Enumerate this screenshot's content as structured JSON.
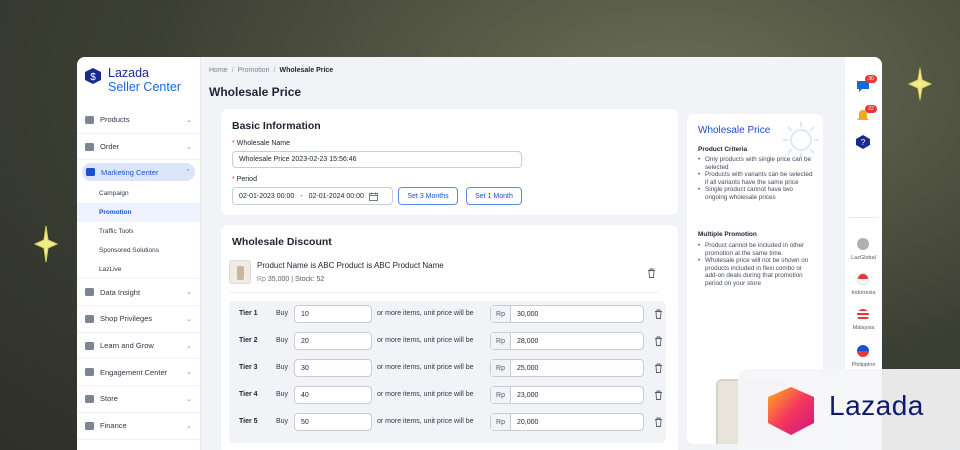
{
  "app": {
    "brand": "Lazada",
    "product": "Seller Center"
  },
  "sidebar": {
    "items": [
      {
        "label": "Products",
        "icon": "box-icon"
      },
      {
        "label": "Order",
        "icon": "order-icon"
      },
      {
        "label": "Marketing Center",
        "icon": "marketing-icon",
        "active": true
      },
      {
        "label": "Data Insight",
        "icon": "chart-icon"
      },
      {
        "label": "Shop Privileges",
        "icon": "shop-icon"
      },
      {
        "label": "Learn and Grow",
        "icon": "learn-icon"
      },
      {
        "label": "Engagement Center",
        "icon": "engagement-icon"
      },
      {
        "label": "Store",
        "icon": "store-icon"
      },
      {
        "label": "Finance",
        "icon": "finance-icon"
      }
    ],
    "sub_items": [
      "Campaign",
      "Promotion",
      "Traffic Tools",
      "Sponsored Solutions",
      "LazLive"
    ],
    "selected_sub": "Promotion"
  },
  "breadcrumb": {
    "home": "Home",
    "promotion": "Promotion",
    "current": "Wholesale Price"
  },
  "page_title": "Wholesale Price",
  "basic_info": {
    "title": "Basic Information",
    "name_label": "Wholesale Name",
    "name_value": "Wholesale Price 2023-02-23 15:56:46",
    "period_label": "Period",
    "period_start": "02-01-2023 00:00",
    "period_sep": "-",
    "period_end": "02-01-2024 00:00",
    "btn_3months": "Set 3 Months",
    "btn_1month": "Set 1 Month"
  },
  "discount": {
    "title": "Wholesale Discount",
    "product_name": "Product Name is ABC Product  is ABC Product Name",
    "currency": "Rp",
    "product_price": "35,000",
    "stock": "Stock: 52",
    "buy_label": "Buy",
    "middle_text": "or more items, unit price will be",
    "tiers": [
      {
        "label": "Tier 1",
        "qty": "10",
        "price": "30,000"
      },
      {
        "label": "Tier 2",
        "qty": "20",
        "price": "28,000"
      },
      {
        "label": "Tier 3",
        "qty": "30",
        "price": "25,000"
      },
      {
        "label": "Tier 4",
        "qty": "40",
        "price": "23,000"
      },
      {
        "label": "Tier 5",
        "qty": "50",
        "price": "20,000"
      }
    ]
  },
  "help": {
    "title": "Wholesale Price",
    "criteria_title": "Product Criteria",
    "criteria": [
      "Only products with single price can be selected",
      "Products with variants can be selected if all variants have the same price",
      "Single product cannot have two ongoing wholesale prices"
    ],
    "multi_title": "Multiple Promotion",
    "multi": [
      "Product cannot be included in other promotion at the same time.",
      "Wholesale price will not be shown on products included in flexi combo or add-on deals during that promotion period on your store"
    ]
  },
  "rightbar": {
    "badges": [
      "30",
      "22"
    ],
    "countries": [
      {
        "label": "LazGlobal",
        "color": "#b0b0b0"
      },
      {
        "label": "Indonesia",
        "color": "#e53935"
      },
      {
        "label": "Malaysia",
        "color": "#1a3a8e"
      },
      {
        "label": "Philippine",
        "color": "#1a4fd0"
      }
    ]
  },
  "watermark": "Lazada",
  "colors": {
    "accent": "#1a4fd0",
    "brand_dark": "#0f1a6e",
    "badge": "#e53935"
  }
}
